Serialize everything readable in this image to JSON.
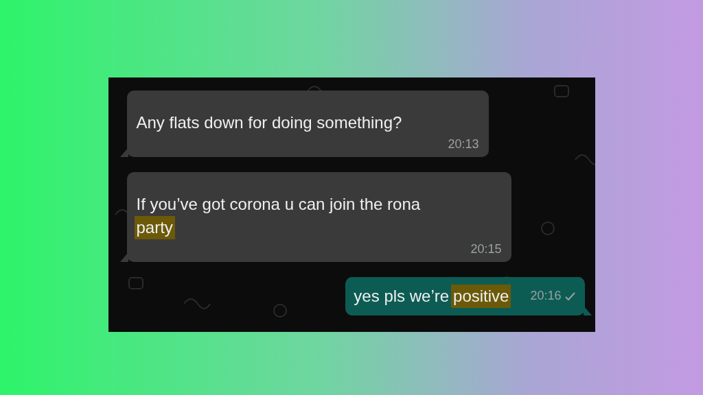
{
  "messages": [
    {
      "kind": "incoming",
      "segments": [
        {
          "text": "Any flats down for doing something?",
          "highlighted": false
        }
      ],
      "time": "20:13"
    },
    {
      "kind": "incoming",
      "segments": [
        {
          "text": "If you’ve got corona u can join the rona",
          "highlighted": false
        },
        {
          "text": "party",
          "highlighted": true
        }
      ],
      "time": "20:15"
    },
    {
      "kind": "outgoing",
      "segments": [
        {
          "text": "yes pls we’re",
          "highlighted": false
        },
        {
          "text": "positive",
          "highlighted": true
        }
      ],
      "time": "20:16",
      "delivered": false
    }
  ]
}
